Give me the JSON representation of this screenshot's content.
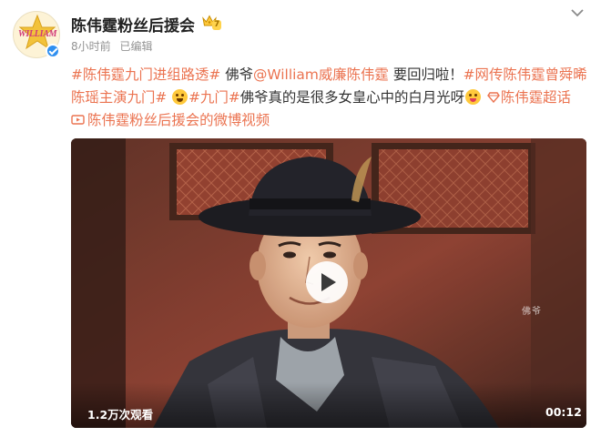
{
  "author": {
    "name": "陈伟霆粉丝后援会",
    "avatar_text": "WILLIAM",
    "vip_level": "7",
    "verified": true
  },
  "meta": {
    "time": "8小时前",
    "edited": "已编辑"
  },
  "post": {
    "line1": {
      "tag1": "#陈伟霆九门进组路透#",
      "text1": "佛爷",
      "mention": "@William威廉陈伟霆",
      "text2": "要回归啦！",
      "tag2": "#网传陈伟霆曾舜晞"
    },
    "line2": {
      "tag2_cont": "陈瑶主演九门#",
      "tag3": "#九门#",
      "text": "佛爷真的是很多女皇心中的白月光呀",
      "supertopic": "陈伟霆超话"
    },
    "line3": {
      "video_link": "陈伟霆粉丝后援会的微博视频"
    },
    "emoji_icons": [
      "laughing-face-emoji",
      "heart-eyes-emoji",
      "gem-icon"
    ]
  },
  "video": {
    "view_count": "1.2万次观看",
    "duration": "00:12",
    "watermark": "佛爷"
  },
  "colors": {
    "accent": "#eb7350",
    "verified": "#2f8ff0",
    "vip": "#ffc93c"
  }
}
